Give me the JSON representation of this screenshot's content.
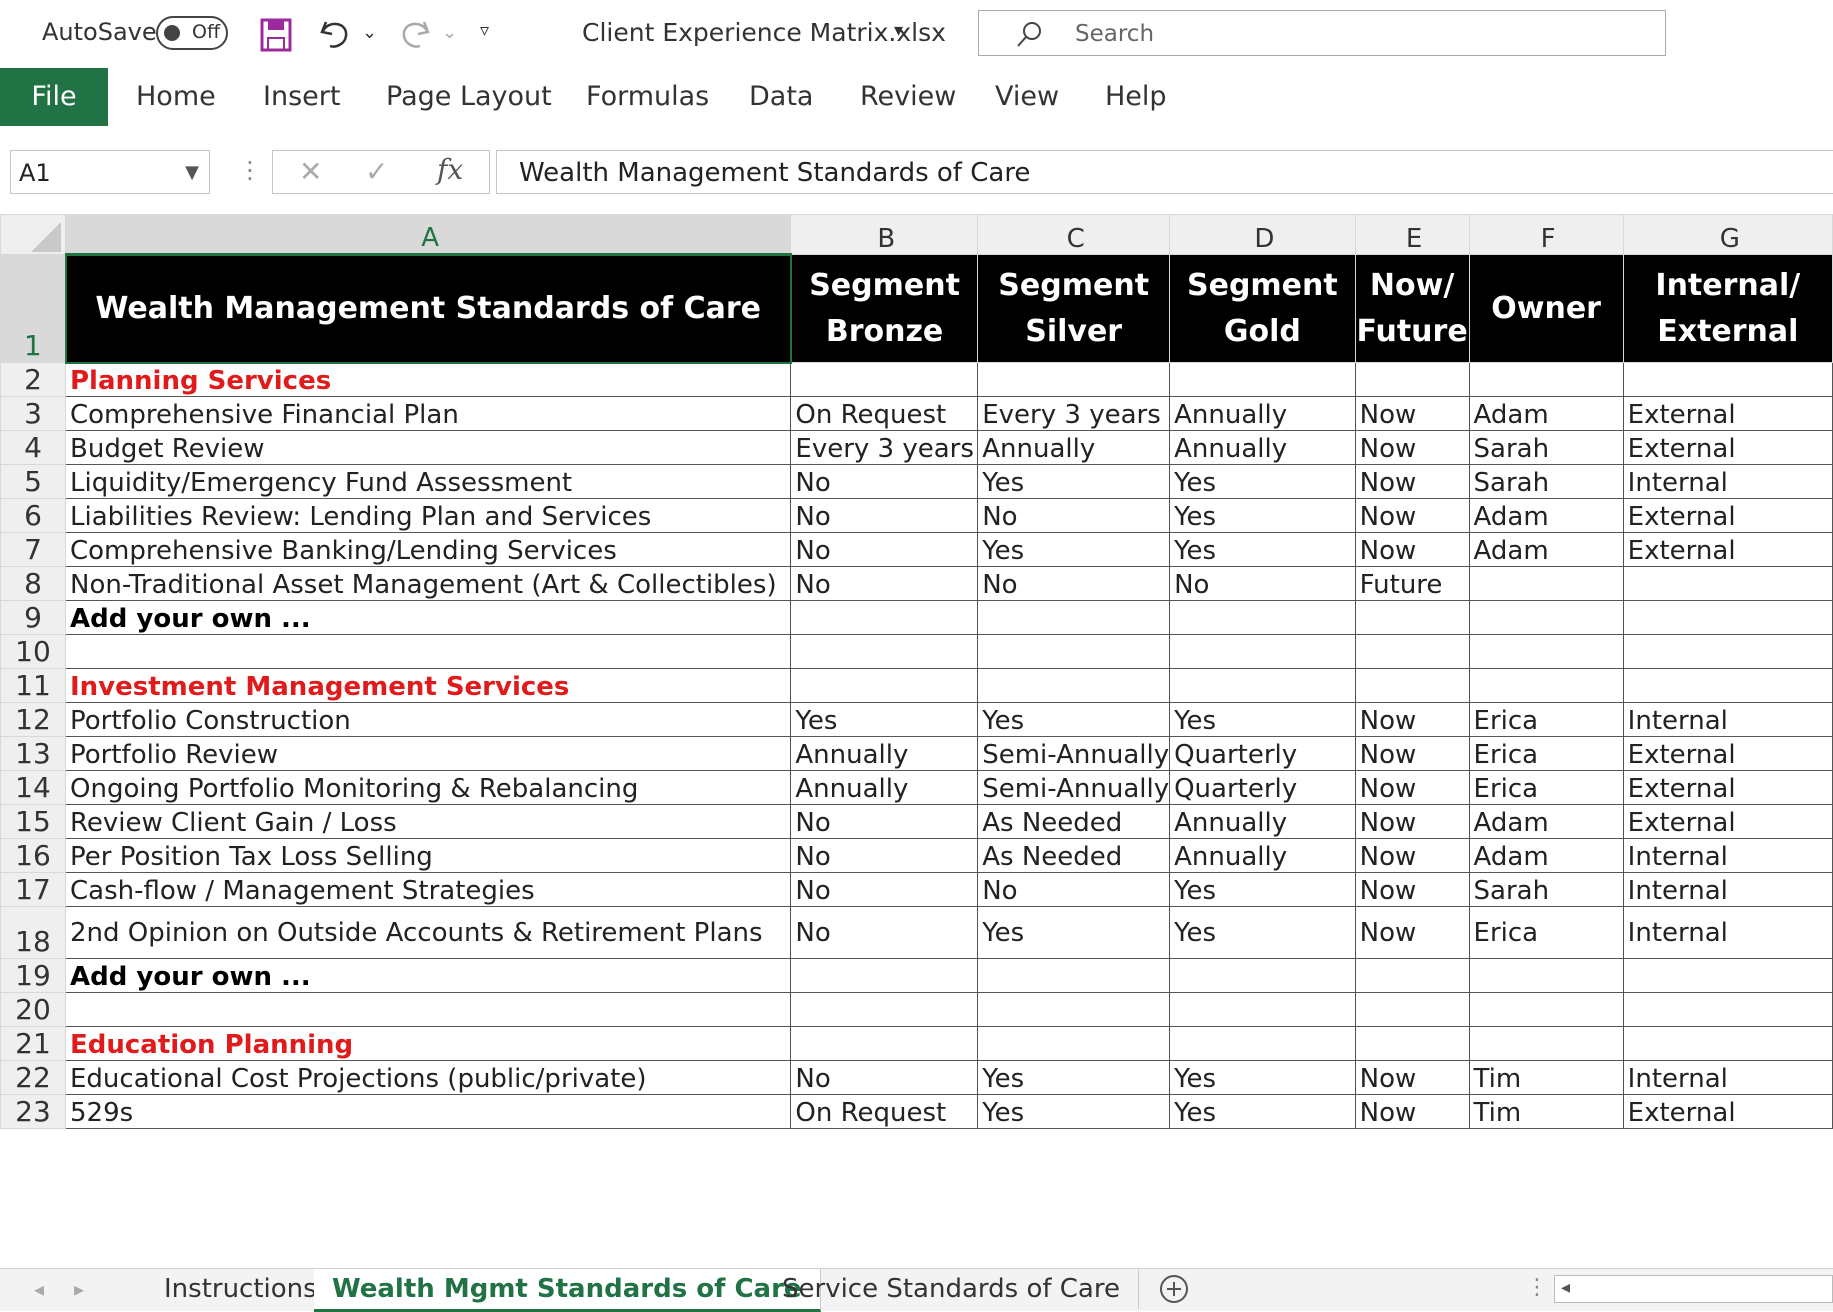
{
  "title_bar": {
    "autosave_label": "AutoSave",
    "autosave_state": "Off",
    "file_name": "Client Experience Matrix.xlsx",
    "search_placeholder": "Search"
  },
  "ribbon": {
    "tabs": [
      "File",
      "Home",
      "Insert",
      "Page Layout",
      "Formulas",
      "Data",
      "Review",
      "View",
      "Help"
    ]
  },
  "formula_bar": {
    "name_box": "A1",
    "fx_label": "fx",
    "value": "Wealth Management Standards of Care"
  },
  "grid": {
    "columns": [
      "A",
      "B",
      "C",
      "D",
      "E",
      "F",
      "G"
    ],
    "header": {
      "row": "1",
      "a": "Wealth Management Standards of Care",
      "b": "Segment Bronze",
      "c": "Segment Silver",
      "d": "Segment Gold",
      "e": "Now/ Future",
      "f": "Owner",
      "g": "Internal/ External"
    },
    "rows": [
      {
        "n": "2",
        "a": "Planning Services",
        "kind": "section",
        "b": "",
        "c": "",
        "d": "",
        "e": "",
        "f": "",
        "g": ""
      },
      {
        "n": "3",
        "a": "Comprehensive Financial Plan",
        "kind": "item",
        "b": "On Request",
        "c": "Every 3 years",
        "d": "Annually",
        "e": "Now",
        "f": "Adam",
        "g": "External"
      },
      {
        "n": "4",
        "a": "Budget Review",
        "kind": "item",
        "b": "Every 3 years",
        "c": "Annually",
        "d": "Annually",
        "e": "Now",
        "f": "Sarah",
        "g": "External"
      },
      {
        "n": "5",
        "a": "Liquidity/Emergency Fund Assessment",
        "kind": "item",
        "b": "No",
        "c": "Yes",
        "d": "Yes",
        "e": "Now",
        "f": "Sarah",
        "g": "Internal"
      },
      {
        "n": "6",
        "a": "Liabilities Review: Lending Plan and Services",
        "kind": "item",
        "b": "No",
        "c": "No",
        "d": "Yes",
        "e": "Now",
        "f": "Adam",
        "g": "External"
      },
      {
        "n": "7",
        "a": "Comprehensive Banking/Lending Services",
        "kind": "item",
        "b": "No",
        "c": "Yes",
        "d": "Yes",
        "e": "Now",
        "f": "Adam",
        "g": "External"
      },
      {
        "n": "8",
        "a": "Non-Traditional Asset Management (Art & Collectibles)",
        "kind": "item",
        "b": "No",
        "c": "No",
        "d": "No",
        "e": "Future",
        "f": "",
        "g": ""
      },
      {
        "n": "9",
        "a": "Add your own ...",
        "kind": "add",
        "b": "",
        "c": "",
        "d": "",
        "e": "",
        "f": "",
        "g": ""
      },
      {
        "n": "10",
        "a": "",
        "kind": "item",
        "b": "",
        "c": "",
        "d": "",
        "e": "",
        "f": "",
        "g": ""
      },
      {
        "n": "11",
        "a": "Investment Management Services",
        "kind": "section",
        "b": "",
        "c": "",
        "d": "",
        "e": "",
        "f": "",
        "g": ""
      },
      {
        "n": "12",
        "a": "Portfolio Construction",
        "kind": "item",
        "b": "Yes",
        "c": "Yes",
        "d": "Yes",
        "e": "Now",
        "f": "Erica",
        "g": "Internal"
      },
      {
        "n": "13",
        "a": "Portfolio Review",
        "kind": "item",
        "b": "Annually",
        "c": "Semi-Annually",
        "d": "Quarterly",
        "e": "Now",
        "f": "Erica",
        "g": "External"
      },
      {
        "n": "14",
        "a": "Ongoing Portfolio Monitoring & Rebalancing",
        "kind": "item",
        "b": "Annually",
        "c": "Semi-Annually",
        "d": "Quarterly",
        "e": "Now",
        "f": "Erica",
        "g": "External"
      },
      {
        "n": "15",
        "a": "Review Client Gain / Loss",
        "kind": "item",
        "b": "No",
        "c": "As Needed",
        "d": "Annually",
        "e": "Now",
        "f": "Adam",
        "g": "External"
      },
      {
        "n": "16",
        "a": "Per Position Tax Loss Selling",
        "kind": "item",
        "b": "No",
        "c": "As Needed",
        "d": "Annually",
        "e": "Now",
        "f": "Adam",
        "g": "Internal"
      },
      {
        "n": "17",
        "a": "Cash-flow / Management Strategies",
        "kind": "item",
        "b": "No",
        "c": "No",
        "d": "Yes",
        "e": "Now",
        "f": "Sarah",
        "g": "Internal"
      },
      {
        "n": "18",
        "a": "2nd Opinion on Outside Accounts & Retirement Plans",
        "kind": "item",
        "b": "No",
        "c": "Yes",
        "d": "Yes",
        "e": "Now",
        "f": "Erica",
        "g": "Internal",
        "tall": true
      },
      {
        "n": "19",
        "a": "Add your own ...",
        "kind": "add",
        "b": "",
        "c": "",
        "d": "",
        "e": "",
        "f": "",
        "g": ""
      },
      {
        "n": "20",
        "a": "",
        "kind": "item",
        "b": "",
        "c": "",
        "d": "",
        "e": "",
        "f": "",
        "g": ""
      },
      {
        "n": "21",
        "a": "Education Planning",
        "kind": "section",
        "b": "",
        "c": "",
        "d": "",
        "e": "",
        "f": "",
        "g": ""
      },
      {
        "n": "22",
        "a": "Educational Cost Projections (public/private)",
        "kind": "item",
        "b": "No",
        "c": "Yes",
        "d": "Yes",
        "e": "Now",
        "f": "Tim",
        "g": "Internal"
      },
      {
        "n": "23",
        "a": "529s",
        "kind": "item",
        "b": "On Request",
        "c": "Yes",
        "d": "Yes",
        "e": "Now",
        "f": "Tim",
        "g": "External"
      }
    ]
  },
  "sheet_tabs": {
    "items": [
      "Instructions",
      "Wealth Mgmt Standards of Care",
      "Service Standards of Care"
    ],
    "active": "Wealth Mgmt Standards of Care"
  },
  "colors": {
    "excel_green": "#217346",
    "section_red": "#e01b1b",
    "header_black": "#000000"
  }
}
